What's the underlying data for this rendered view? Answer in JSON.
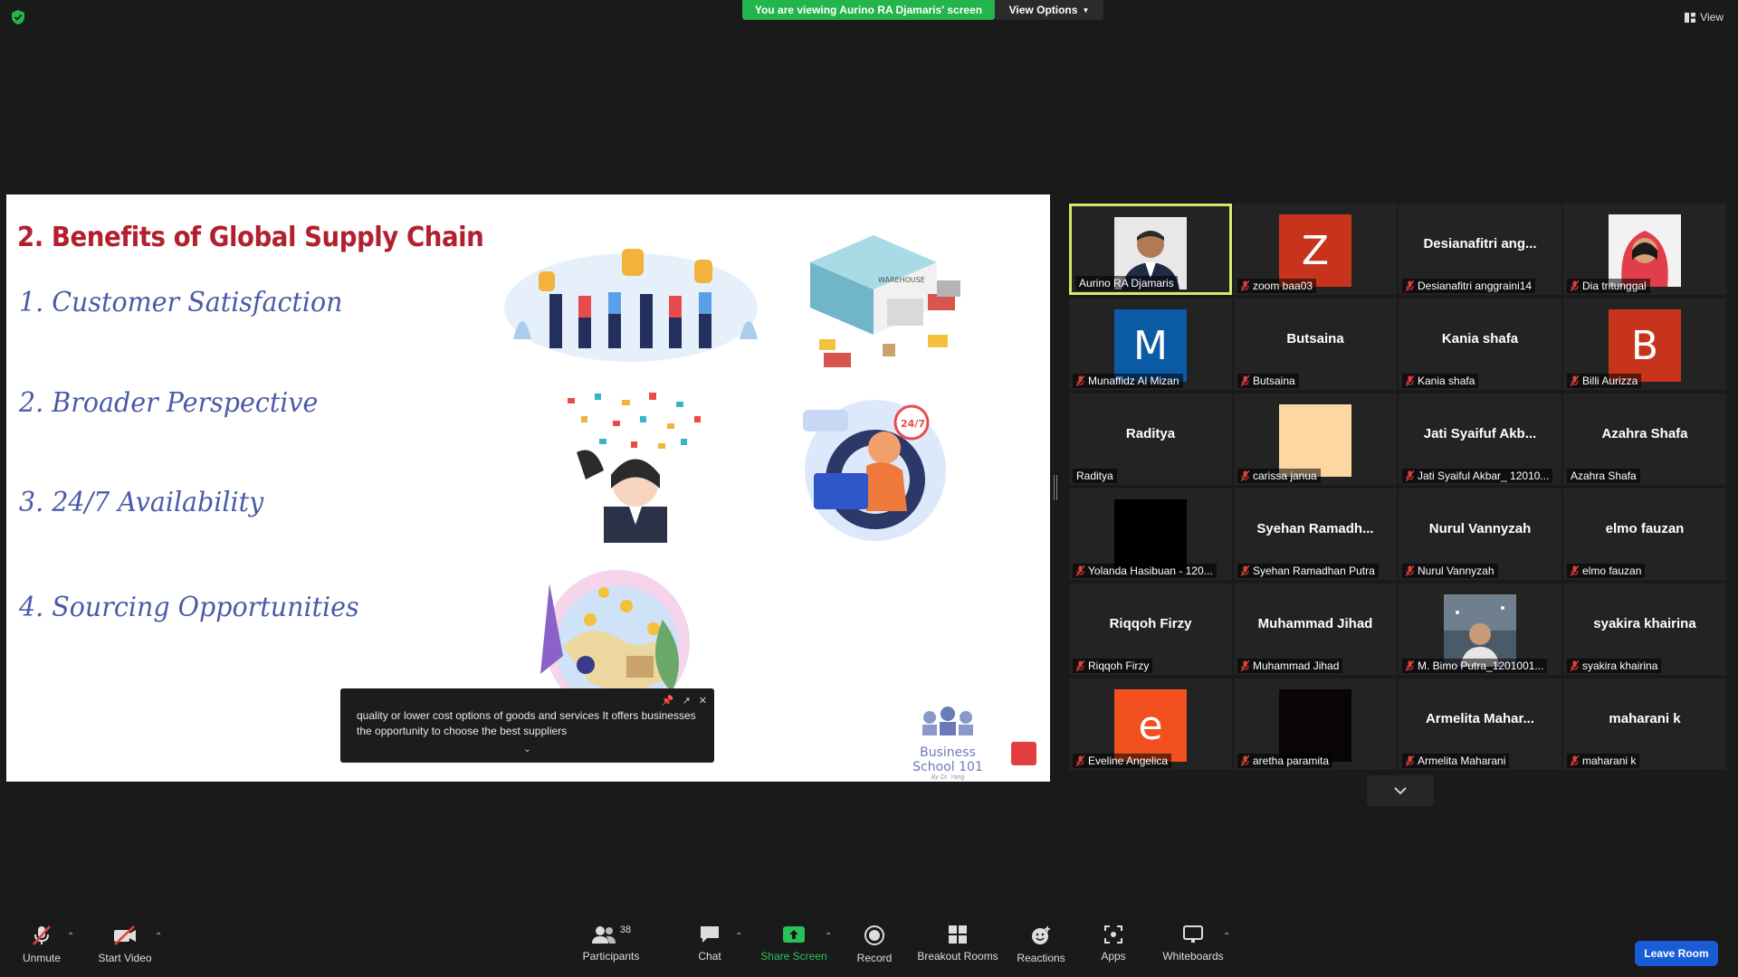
{
  "top": {
    "viewing_banner": "You are viewing Aurino RA Djamaris' screen",
    "view_options": "View Options",
    "view": "View"
  },
  "slide": {
    "title": "2. Benefits of Global Supply Chain",
    "items": [
      "1. Customer Satisfaction",
      "2. Broader Perspective",
      "3. 24/7 Availability",
      "4. Sourcing Opportunities"
    ],
    "logo_text": "Business School 101",
    "logo_sub": "By Dr. Yang",
    "warehouse_label": "WAREHOUSE",
    "badge_247": "24/7"
  },
  "caption": {
    "text": "quality or lower cost options of goods and services It offers businesses the opportunity to choose the best suppliers"
  },
  "participants": [
    {
      "label": "Aurino RA Djamaris",
      "type": "photo",
      "active": true,
      "muted": false
    },
    {
      "label": "zoom baa03",
      "type": "letter",
      "letter": "Z",
      "color": "#c8341b",
      "muted": true
    },
    {
      "label": "Desianafitri anggraini14",
      "center": "Desianafitri ang...",
      "type": "name",
      "muted": true
    },
    {
      "label": "Dia tritunggal",
      "type": "photo2",
      "muted": true
    },
    {
      "label": "Munaffidz Al Mizan",
      "type": "letter",
      "letter": "M",
      "color": "#0b5aa6",
      "muted": true
    },
    {
      "label": "Butsaina",
      "center": "Butsaina",
      "type": "name",
      "muted": true
    },
    {
      "label": "Kania shafa",
      "center": "Kania shafa",
      "type": "name",
      "muted": true
    },
    {
      "label": "Billi Aurizza",
      "type": "letter",
      "letter": "B",
      "color": "#c8341b",
      "muted": true
    },
    {
      "label": "Raditya",
      "center": "Raditya",
      "type": "name",
      "muted": false
    },
    {
      "label": "carissa janua",
      "type": "solid",
      "color": "#fcd8a0",
      "muted": true
    },
    {
      "label": "Jati Syaiful Akbar_ 12010...",
      "center": "Jati Syaifuf Akb...",
      "type": "name",
      "muted": true
    },
    {
      "label": "Azahra Shafa",
      "center": "Azahra Shafa",
      "type": "name",
      "muted": false
    },
    {
      "label": "Yolanda Hasibuan - 120...",
      "type": "solid",
      "color": "#000000",
      "muted": true
    },
    {
      "label": "Syehan Ramadhan Putra",
      "center": "Syehan Ramadh...",
      "type": "name",
      "muted": true
    },
    {
      "label": "Nurul Vannyzah",
      "center": "Nurul Vannyzah",
      "type": "name",
      "muted": true
    },
    {
      "label": "elmo fauzan",
      "center": "elmo fauzan",
      "type": "name",
      "muted": true
    },
    {
      "label": "Riqqoh Firzy",
      "center": "Riqqoh Firzy",
      "type": "name",
      "muted": true
    },
    {
      "label": "Muhammad Jihad",
      "center": "Muhammad Jihad",
      "type": "name",
      "muted": true
    },
    {
      "label": "M. Bimo Putra_1201001...",
      "type": "photo3",
      "muted": true
    },
    {
      "label": "syakira khairina",
      "center": "syakira khairina",
      "type": "name",
      "muted": true
    },
    {
      "label": "Eveline Angelica",
      "type": "letter",
      "letter": "e",
      "color": "#f2501e",
      "muted": true
    },
    {
      "label": "aretha paramita",
      "type": "solid",
      "color": "#0a0505",
      "muted": true
    },
    {
      "label": "Armelita Maharani",
      "center": "Armelita Mahar...",
      "type": "name",
      "muted": true
    },
    {
      "label": "maharani k",
      "center": "maharani k",
      "type": "name",
      "muted": true
    }
  ],
  "toolbar": {
    "unmute": "Unmute",
    "start_video": "Start Video",
    "participants": "Participants",
    "participants_count": "38",
    "chat": "Chat",
    "share_screen": "Share Screen",
    "record": "Record",
    "breakout_rooms": "Breakout Rooms",
    "reactions": "Reactions",
    "apps": "Apps",
    "whiteboards": "Whiteboards",
    "leave_room": "Leave Room"
  },
  "colors": {
    "banner_green": "#23b44c",
    "active_speaker": "#d8e86b",
    "leave_blue": "#1a5bd6",
    "slide_title": "#b3202d",
    "slide_items": "#4a5aa8"
  }
}
